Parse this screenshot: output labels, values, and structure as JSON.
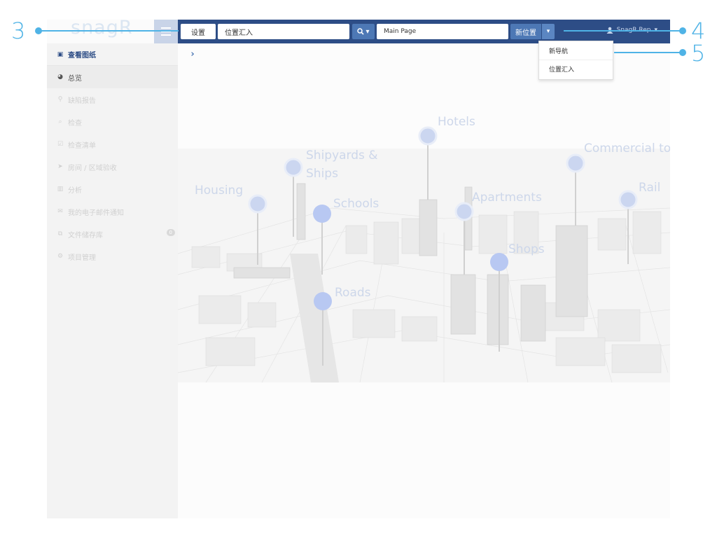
{
  "app": {
    "logo": "snagR"
  },
  "topbar": {
    "settings_label": "设置",
    "location_input": "位置汇入",
    "search_caret": "▾",
    "page_input": "Main Page",
    "new_location_label": "新位置",
    "user_name": "SnagR Rep",
    "user_caret": "▾"
  },
  "dropdown": {
    "items": [
      {
        "label": "新导航"
      },
      {
        "label": "位置汇入"
      }
    ]
  },
  "sidebar": {
    "items": [
      {
        "icon": "image-icon",
        "label": "查看图纸",
        "state": "active"
      },
      {
        "icon": "dashboard-icon",
        "label": "总览",
        "state": "selected"
      },
      {
        "icon": "map-marker-icon",
        "label": "缺陷报告"
      },
      {
        "icon": "search-icon",
        "label": "检查"
      },
      {
        "icon": "checklist-icon",
        "label": "检查清单"
      },
      {
        "icon": "send-icon",
        "label": "房间 / 区域验收"
      },
      {
        "icon": "bar-chart-icon",
        "label": "分析"
      },
      {
        "icon": "envelope-icon",
        "label": "我的电子邮件通知"
      },
      {
        "icon": "files-icon",
        "label": "文件储存库",
        "badge": "0"
      },
      {
        "icon": "cogs-icon",
        "label": "项目管理"
      }
    ]
  },
  "map": {
    "labels": [
      {
        "text": "Housing"
      },
      {
        "text": "Shipyards &"
      },
      {
        "text": "Ships"
      },
      {
        "text": "Schools"
      },
      {
        "text": "Hotels"
      },
      {
        "text": "Apartments"
      },
      {
        "text": "Shops"
      },
      {
        "text": "Roads"
      },
      {
        "text": "Commercial to"
      },
      {
        "text": "Rail"
      }
    ]
  },
  "callouts": {
    "c3": "3",
    "c4": "4",
    "c5": "5"
  },
  "colors": {
    "navbar": "#2d4d86",
    "accent": "#4d78b5",
    "callout": "#4fb3e6"
  }
}
